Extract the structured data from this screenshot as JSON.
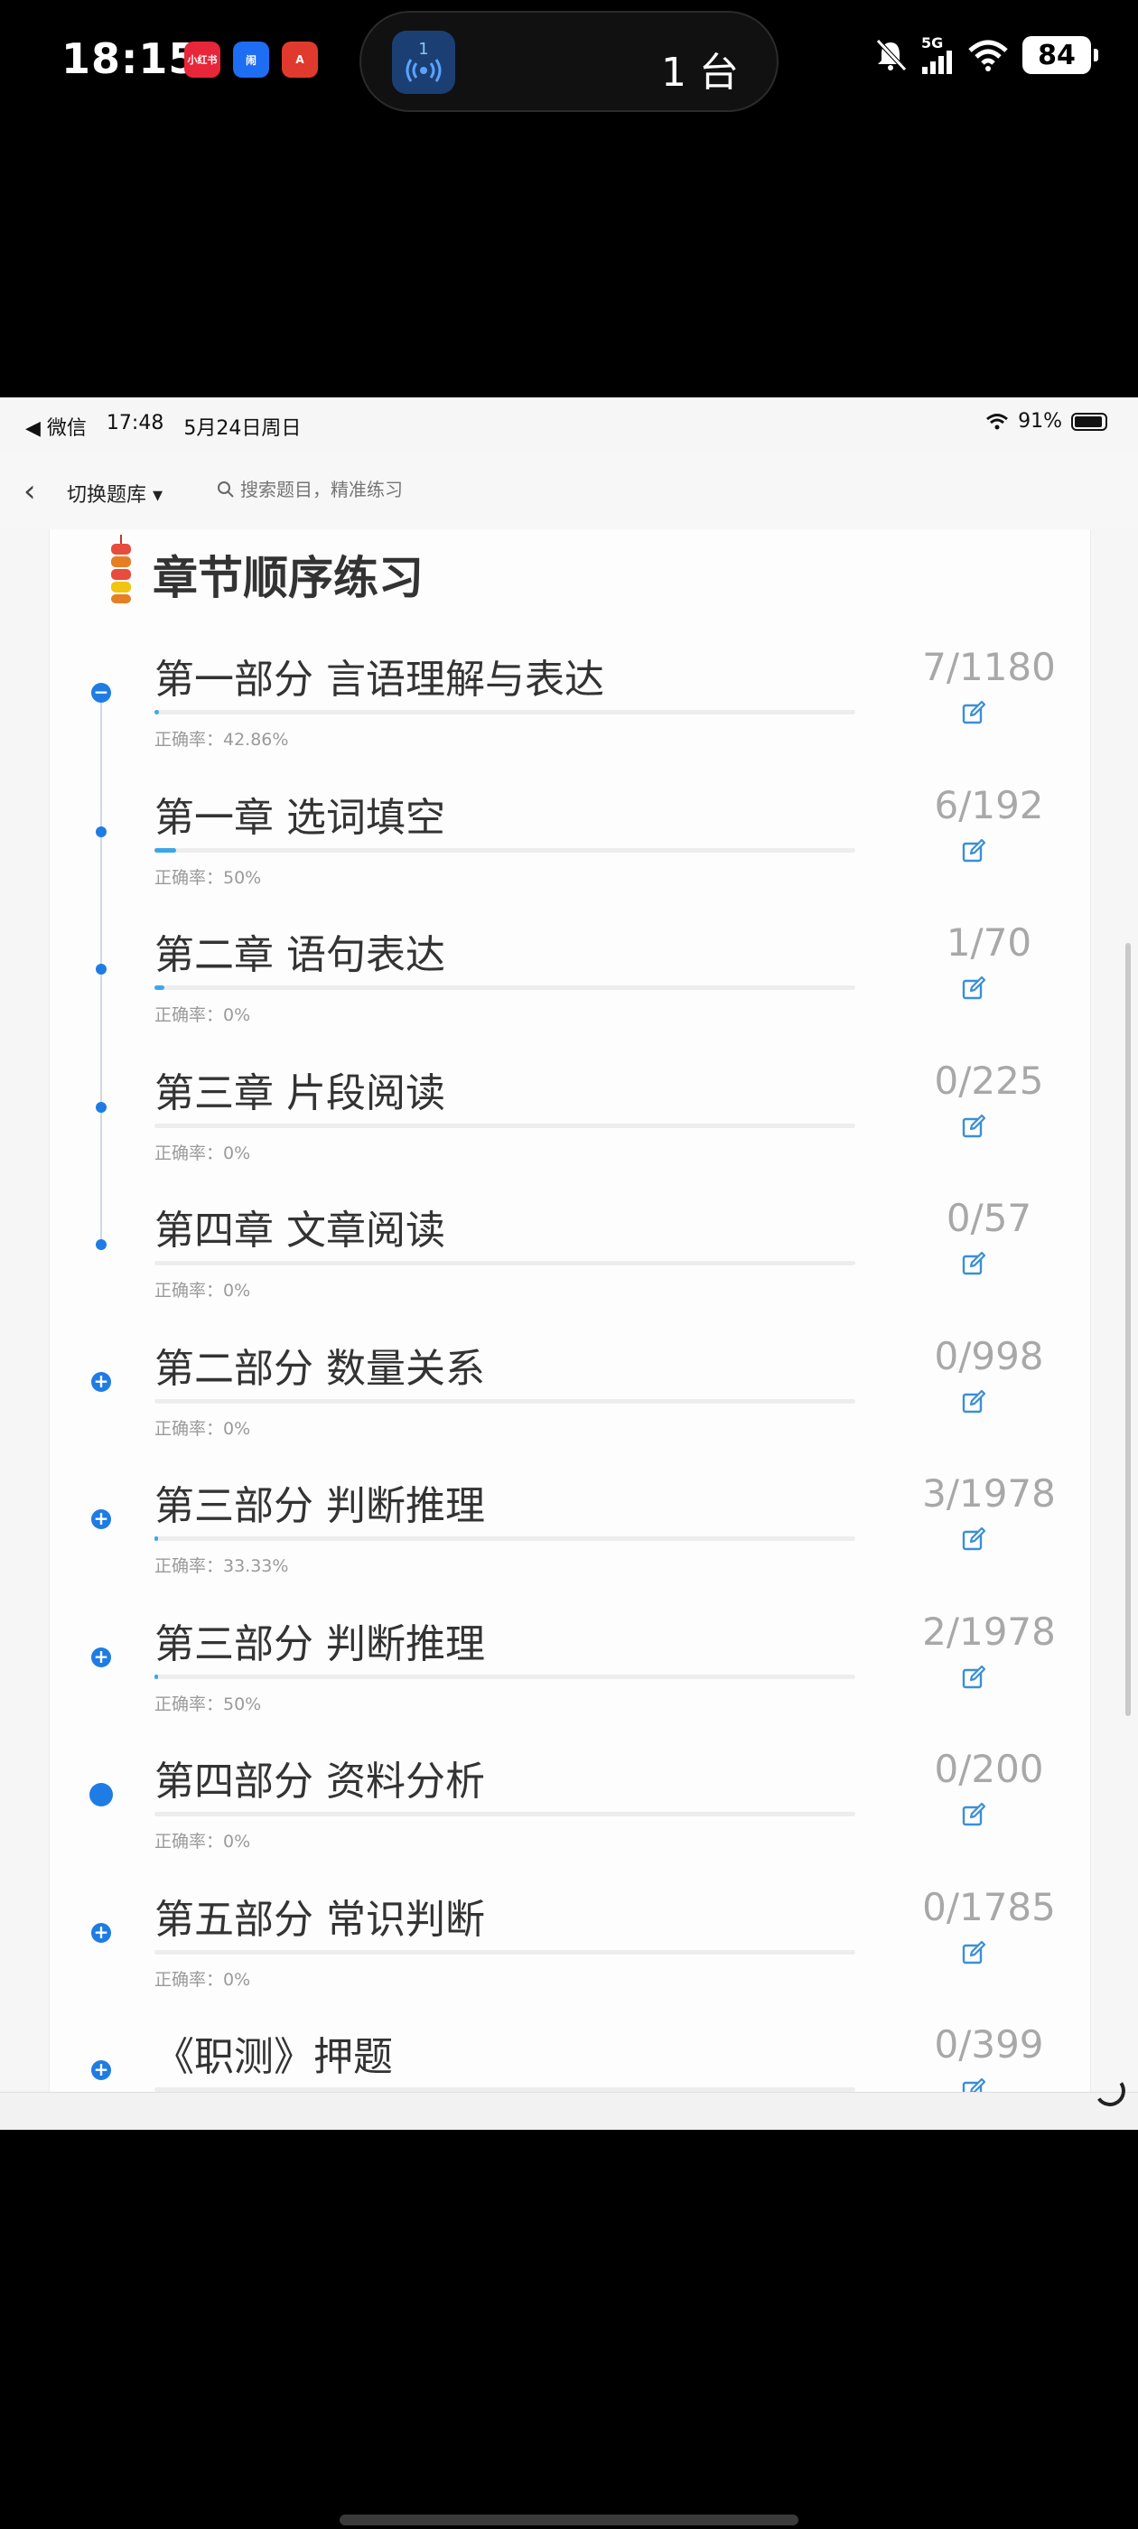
{
  "phone_status": {
    "time": "18:15",
    "apps": [
      "小红书",
      "闹",
      "A"
    ],
    "island_count": "1",
    "island_text": "1 台",
    "signal": "5G",
    "battery": "84"
  },
  "inner_status": {
    "back_app": "◀ 微信",
    "time": "17:48",
    "date": "5月24日周日",
    "battery_text": "91%"
  },
  "nav": {
    "switch_label": "切换题库",
    "search_placeholder": "搜索题目，精准练习"
  },
  "card": {
    "title": "章节顺序练习"
  },
  "items": [
    {
      "title": "第一部分 言语理解与表达",
      "accuracy": "正确率：42.86%",
      "count": "7/1180",
      "progress": 0.006,
      "marker": "collapse"
    },
    {
      "title": "第一章 选词填空",
      "accuracy": "正确率：50%",
      "count": "6/192",
      "progress": 0.031,
      "marker": "dot"
    },
    {
      "title": "第二章 语句表达",
      "accuracy": "正确率：0%",
      "count": "1/70",
      "progress": 0.014,
      "marker": "dot"
    },
    {
      "title": "第三章 片段阅读",
      "accuracy": "正确率：0%",
      "count": "0/225",
      "progress": 0,
      "marker": "dot"
    },
    {
      "title": "第四章 文章阅读",
      "accuracy": "正确率：0%",
      "count": "0/57",
      "progress": 0,
      "marker": "dot"
    },
    {
      "title": "第二部分 数量关系",
      "accuracy": "正确率：0%",
      "count": "0/998",
      "progress": 0,
      "marker": "expand"
    },
    {
      "title": "第三部分 判断推理",
      "accuracy": "正确率：33.33%",
      "count": "3/1978",
      "progress": 0.0015,
      "marker": "expand"
    },
    {
      "title": "第三部分 判断推理",
      "accuracy": "正确率：50%",
      "count": "2/1978",
      "progress": 0.001,
      "marker": "expand"
    },
    {
      "title": "第四部分 资料分析",
      "accuracy": "正确率：0%",
      "count": "0/200",
      "progress": 0,
      "marker": "big"
    },
    {
      "title": "第五部分 常识判断",
      "accuracy": "正确率：0%",
      "count": "0/1785",
      "progress": 0,
      "marker": "expand"
    },
    {
      "title": "《职测》押题",
      "accuracy": "",
      "count": "0/399",
      "progress": 0,
      "marker": "expand"
    }
  ]
}
